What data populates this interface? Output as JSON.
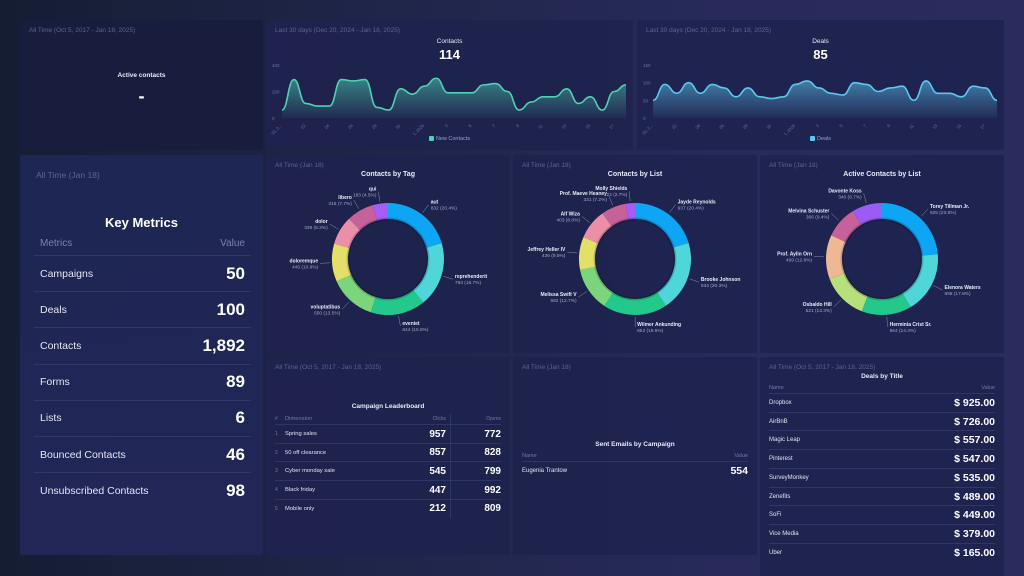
{
  "active_contacts": {
    "subtitle": "All Time (Oct 5, 2017 - Jan 18, 2025)",
    "title": "Active contacts",
    "value": "-"
  },
  "contacts_line": {
    "subtitle": "Last 30 days (Dec 20, 2024 - Jan 18, 2025)",
    "title": "Contacts",
    "value": "114",
    "legend": "New Contacts",
    "color": "#4fd1b5"
  },
  "deals_line": {
    "subtitle": "Last 30 days (Dec 20, 2024 - Jan 18, 2025)",
    "title": "Deals",
    "value": "85",
    "legend": "Deals",
    "color": "#5bc8ef"
  },
  "key_metrics": {
    "subtitle": "All Time (Jan 18)",
    "title": "Key Metrics",
    "col_metric": "Metrics",
    "col_value": "Value",
    "rows": [
      {
        "label": "Campaigns",
        "value": "50"
      },
      {
        "label": "Deals",
        "value": "100"
      },
      {
        "label": "Contacts",
        "value": "1,892"
      },
      {
        "label": "Forms",
        "value": "89"
      },
      {
        "label": "Lists",
        "value": "6"
      },
      {
        "label": "Bounced Contacts",
        "value": "46"
      },
      {
        "label": "Unsubscribed Contacts",
        "value": "98"
      }
    ]
  },
  "pies": [
    {
      "subtitle": "All Time (Jan 18)",
      "title": "Contacts by Tag",
      "slices": [
        {
          "name": "aut",
          "value": 832,
          "pct": "20.4%",
          "color": "#0ea5f5"
        },
        {
          "name": "reprehenderit",
          "value": 763,
          "pct": "18.7%",
          "color": "#4fd6d8"
        },
        {
          "name": "eveniet",
          "value": 644,
          "pct": "15.8%",
          "color": "#22c98a"
        },
        {
          "name": "voluptatibus",
          "value": 550,
          "pct": "13.5%",
          "color": "#7bd57a"
        },
        {
          "name": "doloremque",
          "value": 445,
          "pct": "10.9%",
          "color": "#e3e06a"
        },
        {
          "name": "dolor",
          "value": 339,
          "pct": "8.3%",
          "color": "#ea8fa7"
        },
        {
          "name": "libero",
          "value": 315,
          "pct": "7.7%",
          "color": "#c66199"
        },
        {
          "name": "qui",
          "value": 183,
          "pct": "4.5%",
          "color": "#a75cf5"
        }
      ]
    },
    {
      "subtitle": "All Time (Jan 18)",
      "title": "Contacts by List",
      "slices": [
        {
          "name": "Jayde Reynolds",
          "value": 937,
          "pct": "20.4%",
          "color": "#0ea5f5"
        },
        {
          "name": "Brooke Johnson",
          "value": 934,
          "pct": "20.3%",
          "color": "#4fd6d8"
        },
        {
          "name": "Wilmer Ankunding",
          "value": 853,
          "pct": "18.6%",
          "color": "#22c98a"
        },
        {
          "name": "Melissa Swift V",
          "value": 582,
          "pct": "12.7%",
          "color": "#7bd57a"
        },
        {
          "name": "Jeffrey Heller IV",
          "value": 436,
          "pct": "9.5%",
          "color": "#e3e06a"
        },
        {
          "name": "Alf Wiza",
          "value": 403,
          "pct": "8.8%",
          "color": "#ea8fa7"
        },
        {
          "name": "Prof. Maeve Heaney",
          "value": 331,
          "pct": "7.2%",
          "color": "#c66199"
        },
        {
          "name": "Molly Shields",
          "value": 122,
          "pct": "2.7%",
          "color": "#a75cf5"
        }
      ]
    },
    {
      "subtitle": "All Time (Jan 18)",
      "title": "Active Contacts by List",
      "slices": [
        {
          "name": "Torey Tillman Jr.",
          "value": 925,
          "pct": "23.6%",
          "color": "#0ea5f5"
        },
        {
          "name": "Elenora Waters",
          "value": 698,
          "pct": "17.8%",
          "color": "#4fd6d8"
        },
        {
          "name": "Herminia Crist Sr.",
          "value": 564,
          "pct": "14.4%",
          "color": "#22c98a"
        },
        {
          "name": "Osbaldo Hill",
          "value": 521,
          "pct": "13.3%",
          "color": "#b7e07a"
        },
        {
          "name": "Prof. Aylin Orn",
          "value": 499,
          "pct": "12.8%",
          "color": "#efb894"
        },
        {
          "name": "Melvina Schuster",
          "value": 366,
          "pct": "9.4%",
          "color": "#c66199"
        },
        {
          "name": "Davonte Koss",
          "value": 340,
          "pct": "8.7%",
          "color": "#9a5cf5"
        }
      ]
    }
  ],
  "leaderboard": {
    "subtitle": "All Time (Oct 5, 2017 - Jan 18, 2025)",
    "title": "Campaign Leaderboard",
    "col_num": "#",
    "col_dim": "Dimension",
    "col_clicks": "Clicks",
    "col_opens": "Opens",
    "rows": [
      {
        "rank": "1",
        "name": "Spring sales",
        "clicks": "957",
        "opens": "772"
      },
      {
        "rank": "2",
        "name": "50 off clearance",
        "clicks": "857",
        "opens": "828"
      },
      {
        "rank": "3",
        "name": "Cyber monday sale",
        "clicks": "545",
        "opens": "799"
      },
      {
        "rank": "4",
        "name": "Black friday",
        "clicks": "447",
        "opens": "992"
      },
      {
        "rank": "5",
        "name": "Mobile only",
        "clicks": "212",
        "opens": "809"
      }
    ]
  },
  "sent_emails": {
    "subtitle": "All Time (Jan 18)",
    "title": "Sent Emails by Campaign",
    "col_name": "Name",
    "col_value": "Value",
    "rows": [
      {
        "name": "Eugenia Trantow",
        "value": "554"
      }
    ]
  },
  "deals_by_title": {
    "subtitle": "All Time (Oct 5, 2017 - Jan 18, 2025)",
    "title": "Deals by Title",
    "col_name": "Name",
    "col_value": "Value",
    "rows": [
      {
        "name": "Dropbox",
        "value": "$ 925.00"
      },
      {
        "name": "AirBnB",
        "value": "$ 726.00"
      },
      {
        "name": "Magic Leap",
        "value": "$ 557.00"
      },
      {
        "name": "Pinterest",
        "value": "$ 547.00"
      },
      {
        "name": "SurveyMonkey",
        "value": "$ 535.00"
      },
      {
        "name": "Zenefits",
        "value": "$ 489.00"
      },
      {
        "name": "SoFi",
        "value": "$ 449.00"
      },
      {
        "name": "Vice Media",
        "value": "$ 379.00"
      },
      {
        "name": "Uber",
        "value": "$ 165.00"
      }
    ]
  },
  "chart_data": [
    {
      "type": "area",
      "title": "Contacts",
      "series": [
        {
          "name": "New Contacts",
          "values": [
            60,
            290,
            110,
            90,
            90,
            290,
            280,
            290,
            80,
            60,
            220,
            180,
            240,
            300,
            190,
            190,
            190,
            250,
            260,
            200,
            60,
            120,
            160,
            160,
            220,
            110,
            160,
            60,
            200,
            250
          ]
        }
      ],
      "x_tick_labels": [
        "Dec 20, 2...",
        "22",
        "24",
        "26",
        "28",
        "30",
        "Jan 1, 2025",
        "3",
        "5",
        "7",
        "9",
        "11",
        "13",
        "15",
        "17"
      ],
      "y_tick_labels": [
        "0",
        "200",
        "400"
      ],
      "ylim": [
        0,
        400
      ],
      "legend": "bottom"
    },
    {
      "type": "area",
      "title": "Deals",
      "series": [
        {
          "name": "Deals",
          "values": [
            50,
            95,
            70,
            100,
            70,
            95,
            85,
            60,
            85,
            60,
            55,
            60,
            95,
            105,
            85,
            70,
            65,
            100,
            95,
            75,
            85,
            90,
            50,
            105,
            70,
            70,
            60,
            90,
            85,
            50
          ]
        }
      ],
      "x_tick_labels": [
        "Dec 20, 2...",
        "22",
        "24",
        "26",
        "28",
        "30",
        "Jan 1, 2025",
        "3",
        "5",
        "7",
        "9",
        "11",
        "13",
        "15",
        "17"
      ],
      "y_tick_labels": [
        "0",
        "50",
        "100",
        "150"
      ],
      "ylim": [
        0,
        150
      ],
      "legend": "bottom"
    }
  ]
}
